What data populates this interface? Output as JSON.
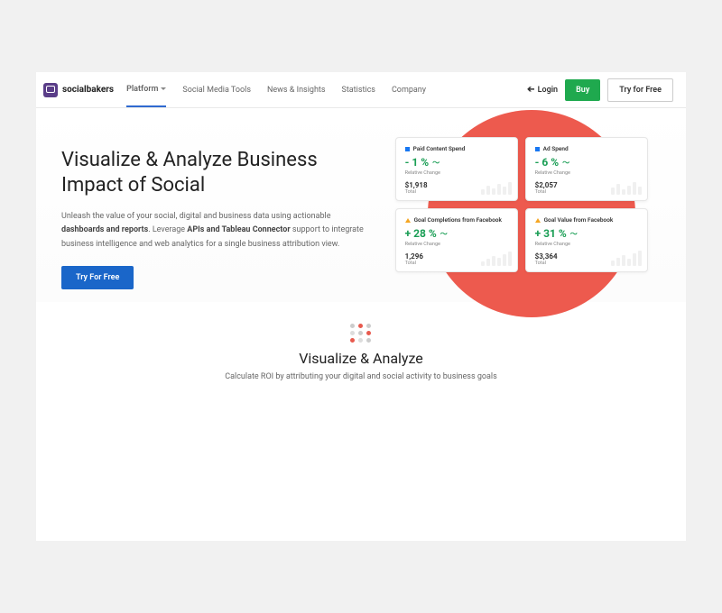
{
  "brand": "socialbakers",
  "nav": {
    "items": [
      "Platform",
      "Social Media Tools",
      "News & Insights",
      "Statistics",
      "Company"
    ],
    "login": "Login",
    "buy": "Buy",
    "try": "Try for Free"
  },
  "hero": {
    "title": "Visualize & Analyze Business Impact of Social",
    "sub_a": "Unleash the value of your social, digital and business data using actionable ",
    "sub_b": "dashboards and reports",
    "sub_c": ". Leverage ",
    "sub_d": "APIs and Tableau Connector",
    "sub_e": " support to integrate business intelligence and web analytics for a single business attribution view.",
    "cta": "Try For Free"
  },
  "cards": [
    {
      "title": "Paid Content Spend",
      "metric": "- 1 %",
      "rel": "Relative Change",
      "total": "$1,918",
      "totlbl": "Total",
      "platform": "fb"
    },
    {
      "title": "Ad Spend",
      "metric": "- 6 %",
      "rel": "Relative Change",
      "total": "$2,057",
      "totlbl": "Total",
      "platform": "fb"
    },
    {
      "title": "Goal Completions from Facebook",
      "metric": "+ 28 %",
      "rel": "Relative Change",
      "total": "1,296",
      "totlbl": "Total",
      "platform": "ga"
    },
    {
      "title": "Goal Value from Facebook",
      "metric": "+ 31 %",
      "rel": "Relative Change",
      "total": "$3,364",
      "totlbl": "Total",
      "platform": "ga"
    }
  ],
  "section": {
    "title": "Visualize & Analyze",
    "sub": "Calculate ROI by attributing your digital and social activity to business goals"
  }
}
